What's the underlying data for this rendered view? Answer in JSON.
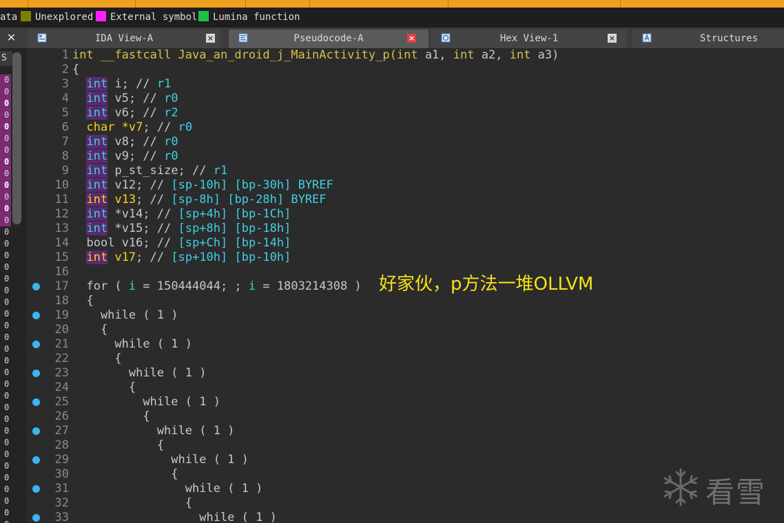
{
  "legend": [
    {
      "label": "ata",
      "color": ""
    },
    {
      "label": "Unexplored",
      "color": "#808000"
    },
    {
      "label": "External symbol",
      "color": "#ff20ff"
    },
    {
      "label": "Lumina function",
      "color": "#20c040"
    }
  ],
  "tabs": [
    {
      "label": "IDA View-A",
      "active": false
    },
    {
      "label": "Pseudocode-A",
      "active": true
    },
    {
      "label": "Hex View-1",
      "active": false
    },
    {
      "label": "Structures",
      "active": false
    }
  ],
  "left_panel": {
    "header": "S",
    "values": [
      "0",
      "0",
      "0",
      "0",
      "0",
      "0",
      "0",
      "0",
      "0",
      "0",
      "0",
      "0",
      "0",
      "0",
      "0",
      "0",
      "0",
      "0",
      "0",
      "0",
      "0",
      "0",
      "0",
      "0",
      "0",
      "0",
      "0",
      "0",
      "0",
      "0",
      "0",
      "0",
      "0",
      "0",
      "0",
      "0",
      "0",
      "0",
      "0",
      "0"
    ]
  },
  "code_lines": [
    {
      "n": "1",
      "bp": false,
      "code": "int __fastcall Java_an_droid_j_MainActivity_p(int a1, int a2, int a3)"
    },
    {
      "n": "2",
      "bp": false,
      "code": "{"
    },
    {
      "n": "3",
      "bp": false,
      "code": "  int i; // r1"
    },
    {
      "n": "4",
      "bp": false,
      "code": "  int v5; // r0"
    },
    {
      "n": "5",
      "bp": false,
      "code": "  int v6; // r2"
    },
    {
      "n": "6",
      "bp": false,
      "code": "  char *v7; // r0"
    },
    {
      "n": "7",
      "bp": false,
      "code": "  int v8; // r0"
    },
    {
      "n": "8",
      "bp": false,
      "code": "  int v9; // r0"
    },
    {
      "n": "9",
      "bp": false,
      "code": "  int p_st_size; // r1"
    },
    {
      "n": "10",
      "bp": false,
      "code": "  int v12; // [sp-10h] [bp-30h] BYREF"
    },
    {
      "n": "11",
      "bp": false,
      "code": "  int v13; // [sp-8h] [bp-28h] BYREF"
    },
    {
      "n": "12",
      "bp": false,
      "code": "  int *v14; // [sp+4h] [bp-1Ch]"
    },
    {
      "n": "13",
      "bp": false,
      "code": "  int *v15; // [sp+8h] [bp-18h]"
    },
    {
      "n": "14",
      "bp": false,
      "code": "  bool v16; // [sp+Ch] [bp-14h]"
    },
    {
      "n": "15",
      "bp": false,
      "code": "  int v17; // [sp+10h] [bp-10h]"
    },
    {
      "n": "16",
      "bp": false,
      "code": ""
    },
    {
      "n": "17",
      "bp": true,
      "code": "  for ( i = 150444044; ; i = 1803214308 )"
    },
    {
      "n": "18",
      "bp": false,
      "code": "  {"
    },
    {
      "n": "19",
      "bp": true,
      "code": "    while ( 1 )"
    },
    {
      "n": "20",
      "bp": false,
      "code": "    {"
    },
    {
      "n": "21",
      "bp": true,
      "code": "      while ( 1 )"
    },
    {
      "n": "22",
      "bp": false,
      "code": "      {"
    },
    {
      "n": "23",
      "bp": true,
      "code": "        while ( 1 )"
    },
    {
      "n": "24",
      "bp": false,
      "code": "        {"
    },
    {
      "n": "25",
      "bp": true,
      "code": "          while ( 1 )"
    },
    {
      "n": "26",
      "bp": false,
      "code": "          {"
    },
    {
      "n": "27",
      "bp": true,
      "code": "            while ( 1 )"
    },
    {
      "n": "28",
      "bp": false,
      "code": "            {"
    },
    {
      "n": "29",
      "bp": true,
      "code": "              while ( 1 )"
    },
    {
      "n": "30",
      "bp": false,
      "code": "              {"
    },
    {
      "n": "31",
      "bp": true,
      "code": "                while ( 1 )"
    },
    {
      "n": "32",
      "bp": false,
      "code": "                {"
    },
    {
      "n": "33",
      "bp": true,
      "code": "                  while ( 1 )"
    }
  ],
  "annotation": "好家伙，p方法一堆OLLVM",
  "watermark": "看雪",
  "colors": {
    "background": "#2b2b2b",
    "keyword": "#d7c24a",
    "identifier": "#3fd0e6",
    "highlight": "#5a2a6e",
    "annotation": "#f6e218",
    "breakpoint": "#3db4f2",
    "top_bar": "#f0a020"
  }
}
